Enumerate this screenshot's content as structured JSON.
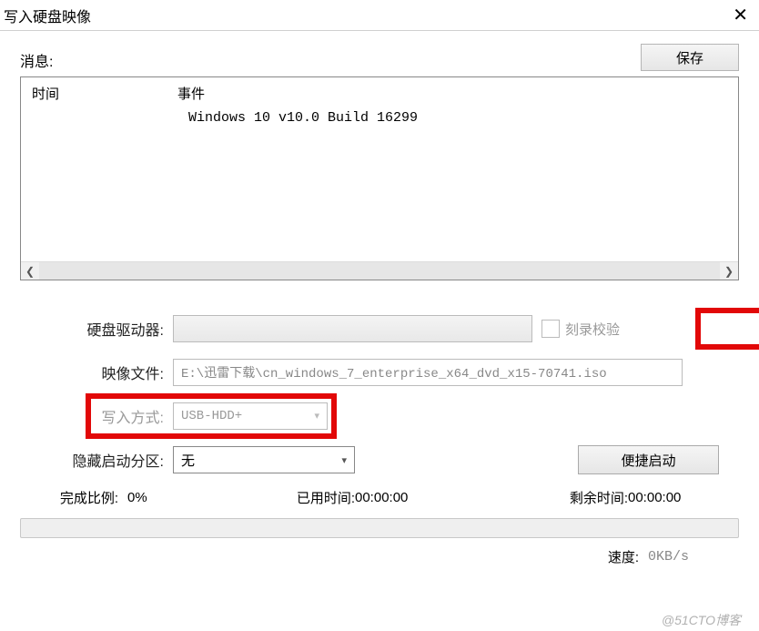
{
  "window": {
    "title": "写入硬盘映像"
  },
  "messages": {
    "label": "消息:",
    "save_label": "保存",
    "col_time": "时间",
    "col_event": "事件",
    "entries": [
      {
        "time": "",
        "event": "Windows 10 v10.0 Build 16299"
      }
    ]
  },
  "form": {
    "drive_label": "硬盘驱动器:",
    "drive_value": "",
    "verify_label": "刻录校验",
    "verify_checked": false,
    "image_label": "映像文件:",
    "image_value": "E:\\迅雷下载\\cn_windows_7_enterprise_x64_dvd_x15-70741.iso",
    "write_mode_label": "写入方式:",
    "write_mode_value": "USB-HDD+",
    "hide_label": "隐藏启动分区:",
    "hide_value": "无",
    "quick_boot_label": "便捷启动"
  },
  "stats": {
    "progress_label": "完成比例:",
    "progress_value": "0%",
    "elapsed_label": "已用时间:",
    "elapsed_value": "00:00:00",
    "remaining_label": "剩余时间:",
    "remaining_value": "00:00:00",
    "speed_label": "速度:",
    "speed_value": "0KB/s"
  },
  "watermark": "@51CTO博客"
}
